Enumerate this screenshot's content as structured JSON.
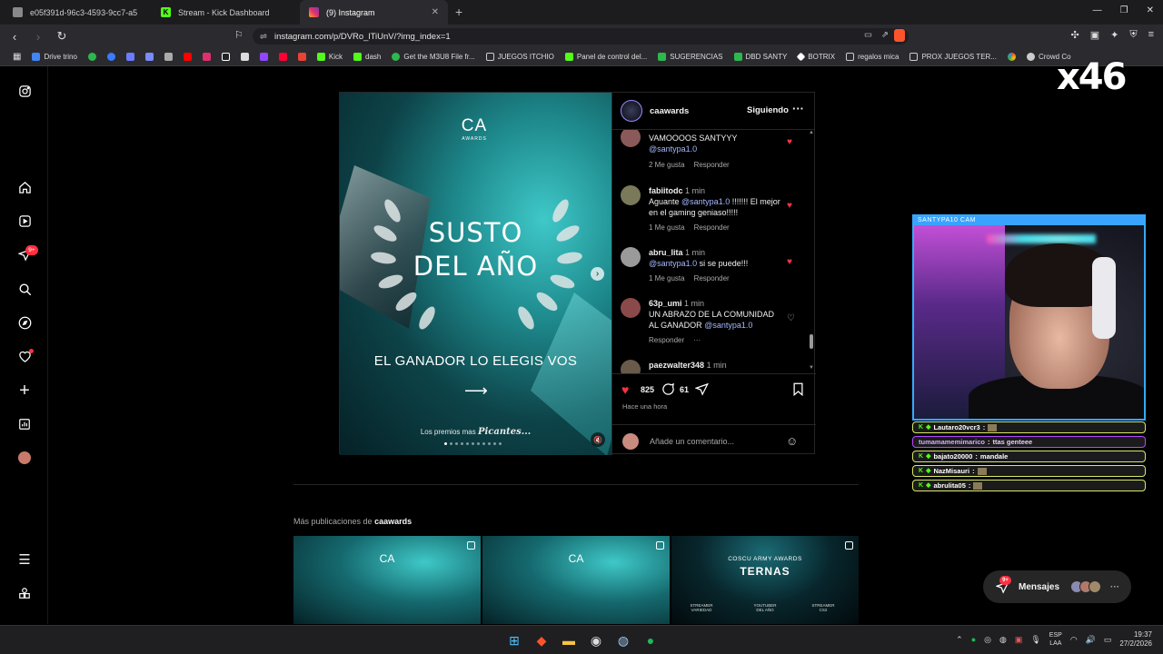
{
  "browser": {
    "tabs": [
      {
        "label": "e05f391d-96c3-4593-9cc7-a587b9b...",
        "color": "#888888"
      },
      {
        "label": "Stream - Kick Dashboard",
        "color": "#53fc18"
      },
      {
        "label": "(9) Instagram",
        "color": "#e1306c"
      }
    ],
    "url": "instagram.com/p/DVRo_lTiUnV/?img_index=1",
    "bookmarks": [
      {
        "label": "Drive trino",
        "color": "#4285f4"
      },
      {
        "label": "",
        "color": "#2db84d"
      },
      {
        "label": "",
        "color": "#3a7bff"
      },
      {
        "label": "",
        "color": "#6c7bff"
      },
      {
        "label": "",
        "color": "#7a8aff"
      },
      {
        "label": "",
        "color": "#aaaaaa"
      },
      {
        "label": "",
        "color": "#ff0000"
      },
      {
        "label": "",
        "color": "#e1306c"
      },
      {
        "label": "",
        "color": "#ffffff"
      },
      {
        "label": "",
        "color": "#dddddd"
      },
      {
        "label": "",
        "color": "#9146ff"
      },
      {
        "label": "",
        "color": "#ff0033"
      },
      {
        "label": "",
        "color": "#ea4335"
      },
      {
        "label": "Kick",
        "color": "#53fc18"
      },
      {
        "label": "dash",
        "color": "#53fc18"
      },
      {
        "label": "Get the M3U8 File fr...",
        "color": "#2db84d"
      },
      {
        "label": "JUEGOS ITCHIO",
        "color": "#cccccc"
      },
      {
        "label": "Panel de control del...",
        "color": "#53fc18"
      },
      {
        "label": "SUGERENCIAS",
        "color": "#2db84d"
      },
      {
        "label": "DBD SANTY",
        "color": "#2db84d"
      },
      {
        "label": "BOTRIX",
        "color": "#ffffff"
      },
      {
        "label": "regalos mica",
        "color": "#cccccc"
      },
      {
        "label": "PROX JUEGOS TER...",
        "color": "#cccccc"
      },
      {
        "label": "",
        "color": "#ea4335"
      },
      {
        "label": "Crowd Co",
        "color": "#cccccc"
      }
    ]
  },
  "nav": {
    "badge_notifications": "9+",
    "badge_messages": "9+"
  },
  "post": {
    "account": "caawards",
    "follow_state": "Siguiendo",
    "image": {
      "logo": "CA",
      "logo_sub": "AWARDS",
      "title_line1": "SUSTO",
      "title_line2": "DEL AÑO",
      "subtitle": "EL GANADOR LO ELEGIS VOS",
      "footer_small": "Los premios mas",
      "footer_bold": "Picantes..."
    },
    "comments": [
      {
        "user": "",
        "time": "",
        "text": "VAMOOOOS SANTYYY",
        "mention": "@santypa1.0",
        "after": "",
        "likes": "2 Me gusta",
        "reply": "Responder",
        "liked": true,
        "avatar": "#8a5a5a"
      },
      {
        "user": "fabiitodc",
        "time": "1 min",
        "text": "Aguante ",
        "mention": "@santypa1.0",
        "after": " !!!!!!! El mejor en el gaming geniaso!!!!!",
        "likes": "1 Me gusta",
        "reply": "Responder",
        "liked": true,
        "avatar": "#7a7a5a"
      },
      {
        "user": "abru_lita",
        "time": "1 min",
        "text": "",
        "mention": "@santypa1.0",
        "after": " si se puede!!!",
        "likes": "1 Me gusta",
        "reply": "Responder",
        "liked": true,
        "avatar": "#9a9a9a"
      },
      {
        "user": "63p_umi",
        "time": "1 min",
        "text": "UN ABRAZO DE LA COMUNIDAD AL GANADOR ",
        "mention": "@santypa1.0",
        "after": "",
        "likes": "",
        "reply": "Responder",
        "liked": false,
        "avatar": "#8a4a4a"
      },
      {
        "user": "paezwalter348",
        "time": "1 min",
        "text": "",
        "mention": "",
        "after": "",
        "likes": "",
        "reply": "",
        "liked": false,
        "avatar": "#6a5a4a"
      }
    ],
    "likes_count": "825",
    "comments_count": "61",
    "posted_ago": "Hace una hora",
    "add_comment_placeholder": "Añade un comentario..."
  },
  "more_posts": {
    "prefix": "Más publicaciones de",
    "account": "caawards",
    "thumbs": [
      {
        "kind": "ca",
        "logo": "CA"
      },
      {
        "kind": "ca",
        "logo": "CA"
      },
      {
        "kind": "ternas",
        "line1": "COSCU ARMY AWARDS",
        "line2": "TERNAS",
        "labels": [
          "STREAMER VARIEDAD",
          "YOUTUBER DEL AÑO",
          "STREAMER CS2"
        ]
      }
    ]
  },
  "messages_button": {
    "label": "Mensajes",
    "badge": "9+"
  },
  "overlay": {
    "multiplier": "x46",
    "cam_title": "SANTYPA10 CAM"
  },
  "chat": [
    {
      "user": "Lautaro20vcr3",
      "msg": "",
      "purple": false
    },
    {
      "user": "tumamamemimarico",
      "msg": "ttas genteee",
      "purple": true
    },
    {
      "user": "bajato20000",
      "msg": "mandale",
      "purple": false
    },
    {
      "user": "NazMisauri",
      "msg": "",
      "purple": false
    },
    {
      "user": "abrulita05",
      "msg": "",
      "purple": false
    }
  ],
  "taskbar": {
    "lang1": "ESP",
    "lang2": "LAA",
    "time": "19:37",
    "date": "27/2/2026"
  }
}
